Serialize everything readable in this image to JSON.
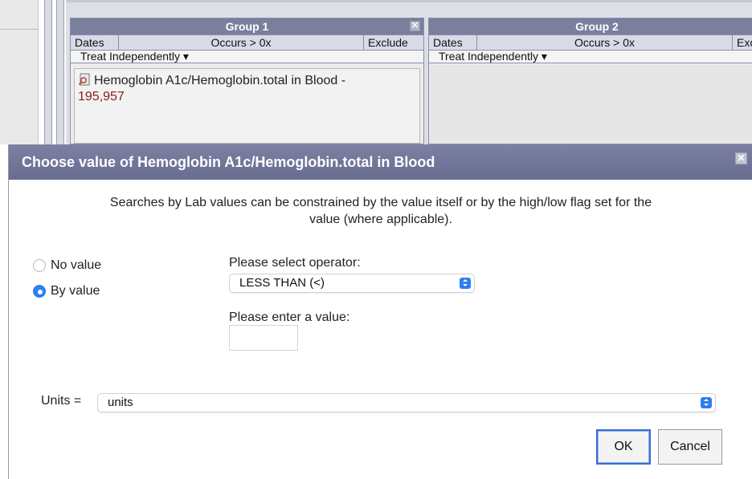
{
  "groups": [
    {
      "title": "Group 1",
      "col_dates": "Dates",
      "col_occurs": "Occurs > 0x",
      "col_exclude": "Exclude",
      "treat": "Treat Independently ▾",
      "concept_label": "Hemoglobin A1c/Hemoglobin.total in Blood -",
      "concept_count": "195,957"
    },
    {
      "title": "Group 2",
      "col_dates": "Dates",
      "col_occurs": "Occurs > 0x",
      "col_exclude": "Excl",
      "treat": "Treat Independently ▾"
    }
  ],
  "dialog": {
    "title": "Choose value of Hemoglobin A1c/Hemoglobin.total in Blood",
    "close_glyph": "✕",
    "description_line1": "Searches by Lab values can be constrained by the value itself or by the high/low flag set for the",
    "description_line2": "value (where applicable).",
    "radio_options": [
      {
        "label": "No value",
        "selected": false
      },
      {
        "label": "By value",
        "selected": true
      }
    ],
    "operator_label": "Please select operator:",
    "operator_value": "LESS THAN (<)",
    "value_label": "Please enter a value:",
    "value_input": "",
    "units_label": "Units =",
    "units_value": "units",
    "ok_label": "OK",
    "cancel_label": "Cancel"
  },
  "colors": {
    "title_bar": "#6e7396",
    "accent_blue": "#2d7ff0",
    "count_red": "#8b1a1a"
  },
  "icons": {
    "concept": "lab-document-icon",
    "close": "close-icon",
    "select": "select-arrows-icon"
  }
}
